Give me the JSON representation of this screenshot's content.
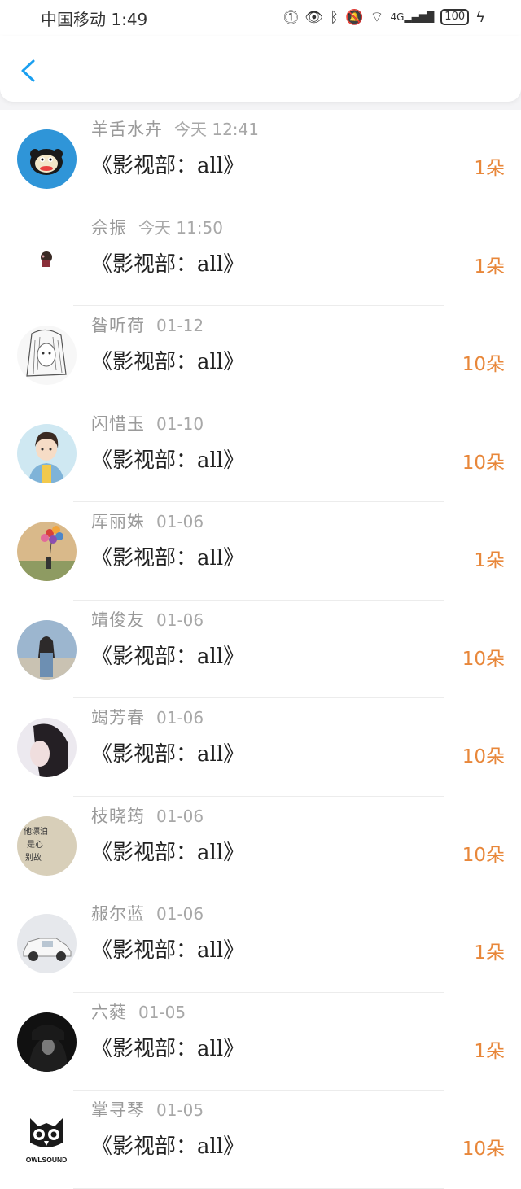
{
  "status": {
    "carrier_time": "中国移动 1:49",
    "net_label": "4G",
    "battery": "100"
  },
  "nav": {
    "back_icon": "chevron-left-icon",
    "accent": "#1a9ff0"
  },
  "items": [
    {
      "name": "羊舌水卉",
      "time": "今天 12:41",
      "title": "《影视部：all》",
      "count": "1朵",
      "avatar": "monkey"
    },
    {
      "name": "佘振",
      "time": "今天 11:50",
      "title": "《影视部：all》",
      "count": "1朵",
      "avatar": "small-figure"
    },
    {
      "name": "昝听荷",
      "time": "01-12",
      "title": "《影视部：all》",
      "count": "10朵",
      "avatar": "sketch-girl"
    },
    {
      "name": "闪惜玉",
      "time": "01-10",
      "title": "《影视部：all》",
      "count": "10朵",
      "avatar": "cartoon-girl"
    },
    {
      "name": "厍丽姝",
      "time": "01-06",
      "title": "《影视部：all》",
      "count": "1朵",
      "avatar": "balloons"
    },
    {
      "name": "靖俊友",
      "time": "01-06",
      "title": "《影视部：all》",
      "count": "10朵",
      "avatar": "beach-girl"
    },
    {
      "name": "竭芳春",
      "time": "01-06",
      "title": "《影视部：all》",
      "count": "10朵",
      "avatar": "dark-hair"
    },
    {
      "name": "枝晓筠",
      "time": "01-06",
      "title": "《影视部：all》",
      "count": "10朵",
      "avatar": "handwriting"
    },
    {
      "name": "赧尔蓝",
      "time": "01-06",
      "title": "《影视部：all》",
      "count": "1朵",
      "avatar": "vintage-car"
    },
    {
      "name": "六蕤",
      "time": "01-05",
      "title": "《影视部：all》",
      "count": "1朵",
      "avatar": "dark-portrait"
    },
    {
      "name": "掌寻琴",
      "time": "01-05",
      "title": "《影视部：all》",
      "count": "10朵",
      "avatar": "owl-logo",
      "logo_text": "OWLSOUND"
    }
  ]
}
